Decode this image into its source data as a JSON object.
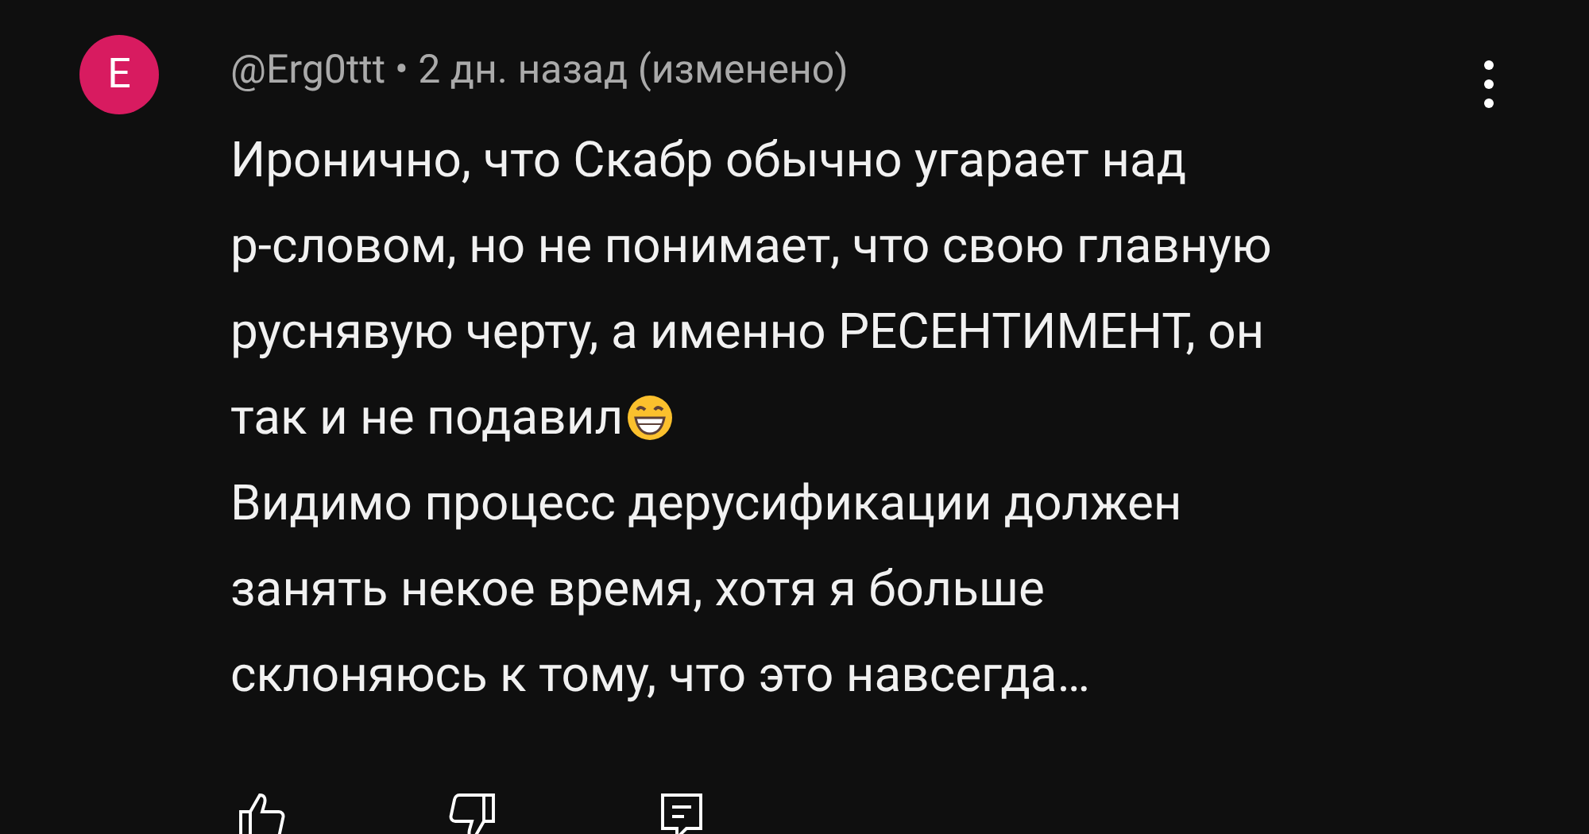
{
  "comment": {
    "avatar_letter": "E",
    "author": "@Erg0ttt",
    "meta": "• 2 дн. назад (изменено)",
    "paragraphs": [
      [
        "Иронично, что Скабр обычно угарает над",
        "р-словом, но не понимает, что свою главную",
        "руснявую черту, а именно РЕСЕНТИМЕНТ, он",
        "так и не подавил"
      ],
      [
        "Видимо процесс дерусификации должен",
        "занять некое время, хотя я больше",
        "склоняюсь к тому, что это навсегда…"
      ]
    ]
  }
}
